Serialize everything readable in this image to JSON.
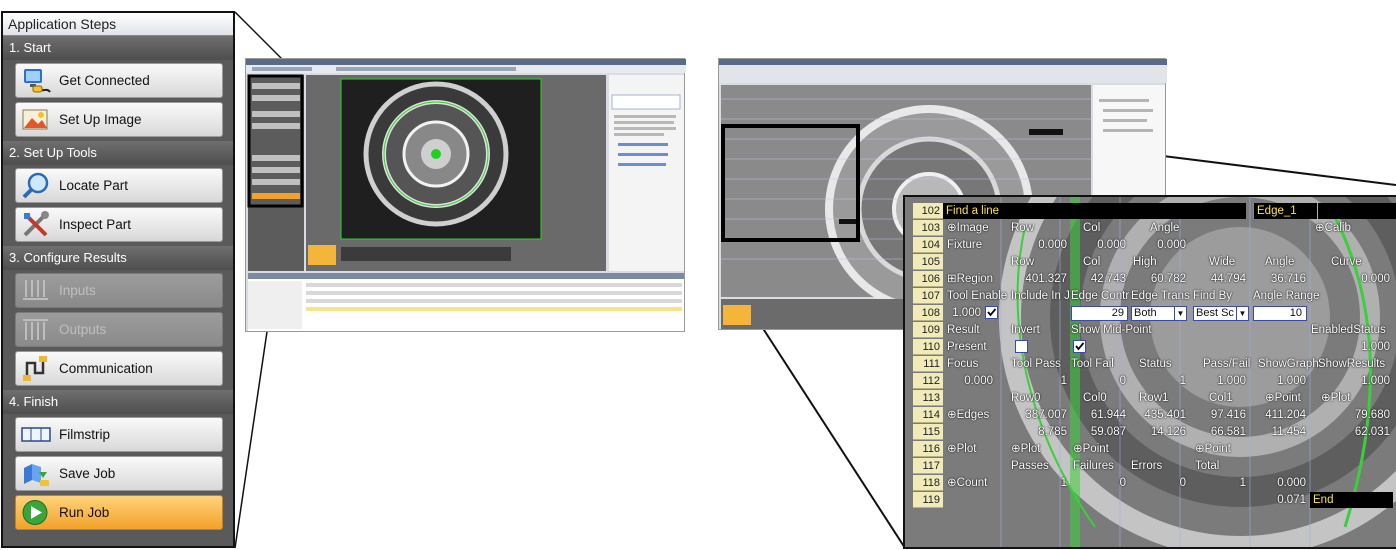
{
  "panel": {
    "title": "Application Steps",
    "sections": [
      {
        "label": "1. Start",
        "buttons": [
          {
            "label": "Get Connected",
            "icon": "connect-icon",
            "state": "normal"
          },
          {
            "label": "Set Up Image",
            "icon": "image-icon",
            "state": "normal"
          }
        ]
      },
      {
        "label": "2. Set Up Tools",
        "buttons": [
          {
            "label": "Locate Part",
            "icon": "magnifier-icon",
            "state": "normal"
          },
          {
            "label": "Inspect Part",
            "icon": "tools-icon",
            "state": "normal"
          }
        ]
      },
      {
        "label": "3. Configure Results",
        "buttons": [
          {
            "label": "Inputs",
            "icon": "inputs-icon",
            "state": "disabled"
          },
          {
            "label": "Outputs",
            "icon": "outputs-icon",
            "state": "disabled"
          },
          {
            "label": "Communication",
            "icon": "communication-icon",
            "state": "normal"
          }
        ]
      },
      {
        "label": "4. Finish",
        "buttons": [
          {
            "label": "Filmstrip",
            "icon": "filmstrip-icon",
            "state": "normal"
          },
          {
            "label": "Save Job",
            "icon": "save-icon",
            "state": "normal"
          },
          {
            "label": "Run Job",
            "icon": "play-icon",
            "state": "active"
          }
        ]
      }
    ]
  },
  "spreadsheet": {
    "header": {
      "row": "102",
      "text": "Find a line",
      "name": "Edge_1"
    },
    "rows": {
      "r103": {
        "n": "103",
        "a": "⊕Image",
        "b": "Row",
        "c": "Col",
        "d": "Angle",
        "h": "⊕Calib"
      },
      "r104": {
        "n": "104",
        "a": "Fixture",
        "b": "0.000",
        "c": "0.000",
        "d": "0.000"
      },
      "r105": {
        "n": "105",
        "b": "Row",
        "c": "Col",
        "d": "High",
        "e": "Wide",
        "f": "Angle",
        "g": "Curve"
      },
      "r106": {
        "n": "106",
        "a": "⊞Region",
        "b": "401.327",
        "c": "42.743",
        "d": "60.782",
        "e": "44.794",
        "f": "36.716",
        "g": "0.000"
      },
      "r107": {
        "n": "107",
        "a": "Tool Enable",
        "b": "Include In J",
        "c": "Edge Contr",
        "d": "Edge Trans",
        "e": "Find By",
        "f": "Angle Range"
      },
      "r108": {
        "n": "108",
        "a": "1.000",
        "c": "29",
        "d": "Both",
        "e": "Best Sc",
        "f": "10"
      },
      "r109": {
        "n": "109",
        "a": "Result",
        "b": "Invert",
        "c": "Show Mid-Point",
        "g": "EnabledStatus"
      },
      "r110": {
        "n": "110",
        "a": "Present",
        "g": "1.000"
      },
      "r111": {
        "n": "111",
        "a": "Focus",
        "b": "Tool Pass",
        "c": "Tool Fail",
        "d": "Status",
        "e": "Pass/Fail",
        "f": "ShowGraph",
        "g": "ShowResults"
      },
      "r112": {
        "n": "112",
        "a": "0.000",
        "b": "1",
        "c": "0",
        "d": "1",
        "e": "1.000",
        "f": "1.000",
        "g": "1.000"
      },
      "r113": {
        "n": "113",
        "b": "Row0",
        "c": "Col0",
        "d": "Row1",
        "e": "Col1",
        "f": "⊕Point",
        "g": "⊕Plot"
      },
      "r114": {
        "n": "114",
        "a": "⊕Edges",
        "b": "387.007",
        "c": "61.944",
        "d": "435.401",
        "e": "97.416",
        "f": "411.204",
        "g": "79.680"
      },
      "r115": {
        "n": "115",
        "b": "8.785",
        "c": "59.087",
        "d": "14.126",
        "e": "66.581",
        "f": "11.454",
        "g": "62.031"
      },
      "r116": {
        "n": "116",
        "a": "⊕Plot",
        "b": "⊕Plot",
        "c": "⊕Point",
        "e": "⊕Point"
      },
      "r117": {
        "n": "117",
        "b": "Passes",
        "c": "Failures",
        "d": "Errors",
        "e": "Total"
      },
      "r118": {
        "n": "118",
        "a": "⊕Count",
        "b": "1",
        "c": "0",
        "d": "0",
        "e": "1",
        "f": "0.000"
      },
      "r119": {
        "n": "119",
        "f": "0.071",
        "g": "End"
      }
    }
  }
}
